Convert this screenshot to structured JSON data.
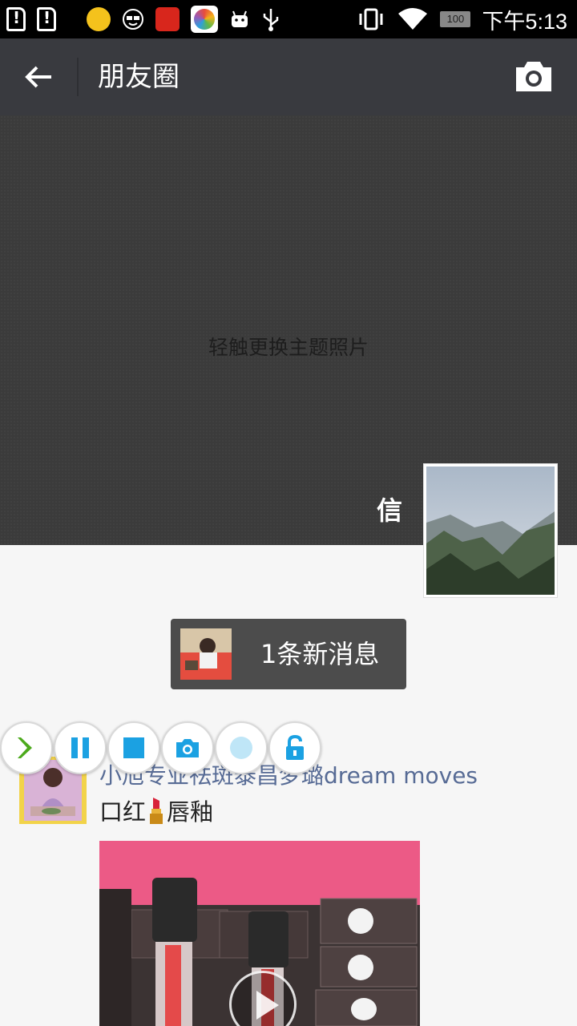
{
  "status_bar": {
    "battery": "100",
    "time": "下午5:13"
  },
  "action_bar": {
    "title": "朋友圈"
  },
  "cover": {
    "hint": "轻触更换主题照片",
    "nickname": "信"
  },
  "new_message": {
    "label": "1条新消息"
  },
  "post": {
    "author": "小旭专业祛斑泰昌梦璐dream moves",
    "text_before": "口红",
    "text_after": "唇釉"
  },
  "colors": {
    "action_bar_bg": "#393a3f",
    "link_blue": "#576b95",
    "recorder_accent": "#1ba1e2"
  }
}
